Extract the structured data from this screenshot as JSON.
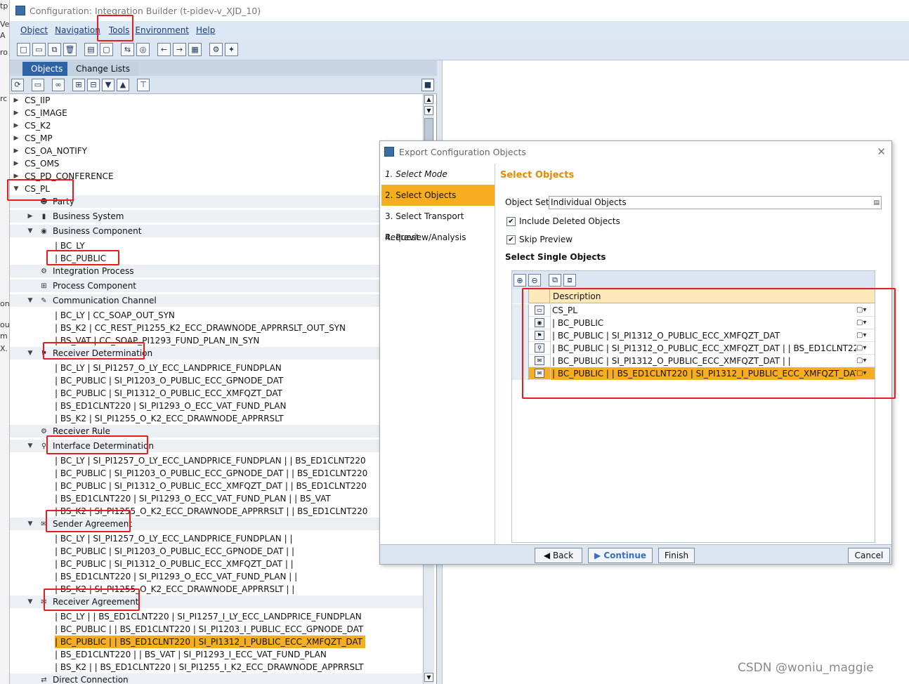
{
  "window": {
    "title": "Configuration: Integration Builder (t-pidev-v_XJD_10)"
  },
  "menu": [
    "Object",
    "Navigation",
    "Tools",
    "Environment",
    "Help"
  ],
  "background_strip": [
    "tp",
    "Ve",
    "A",
    "ro",
    "rc",
    "on",
    "ou",
    "m",
    "X."
  ],
  "left_pane": {
    "tabs": [
      "Objects",
      "Change Lists"
    ],
    "tree": [
      {
        "label": "CS_IIP",
        "arrow": "▶",
        "icon": "none"
      },
      {
        "label": "CS_IMAGE",
        "arrow": "▶",
        "icon": "none"
      },
      {
        "label": "CS_K2",
        "arrow": "▶",
        "icon": "none"
      },
      {
        "label": "CS_MP",
        "arrow": "▶",
        "icon": "none"
      },
      {
        "label": "CS_OA_NOTIFY",
        "arrow": "▶",
        "icon": "none"
      },
      {
        "label": "CS_OMS",
        "arrow": "▶",
        "icon": "none"
      },
      {
        "label": "CS_PD_CONFERENCE",
        "arrow": "▶",
        "icon": "none"
      },
      {
        "label": "CS_PL",
        "arrow": "▼",
        "icon": "none"
      },
      {
        "label": "Party",
        "arrow": "",
        "icon": "party-icon"
      },
      {
        "label": "Business System",
        "arrow": "▶",
        "icon": "business-system-icon"
      },
      {
        "label": "Business Component",
        "arrow": "▼",
        "icon": "business-component-icon"
      },
      {
        "label": "| BC_LY",
        "arrow": "",
        "icon": "none"
      },
      {
        "label": "| BC_PUBLIC",
        "arrow": "",
        "icon": "none"
      },
      {
        "label": "Integration Process",
        "arrow": "",
        "icon": "integration-process-icon"
      },
      {
        "label": "Process Component",
        "arrow": "",
        "icon": "process-component-icon"
      },
      {
        "label": "Communication Channel",
        "arrow": "▼",
        "icon": "channel-icon"
      },
      {
        "label": "| BC_LY | CC_SOAP_OUT_SYN",
        "arrow": "",
        "icon": "none"
      },
      {
        "label": "| BS_K2 | CC_REST_PI1255_K2_ECC_DRAWNODE_APPRRSLT_OUT_SYN",
        "arrow": "",
        "icon": "none"
      },
      {
        "label": "| BS_VAT | CC_SOAP_PI1293_FUND_PLAN_IN_SYN",
        "arrow": "",
        "icon": "none"
      },
      {
        "label": "Receiver Determination",
        "arrow": "▼",
        "icon": "receiver-determination-icon"
      },
      {
        "label": "| BC_LY | SI_PI1257_O_LY_ECC_LANDPRICE_FUNDPLAN",
        "arrow": "",
        "icon": "none"
      },
      {
        "label": "| BC_PUBLIC | SI_PI1203_O_PUBLIC_ECC_GPNODE_DAT",
        "arrow": "",
        "icon": "none"
      },
      {
        "label": "| BC_PUBLIC | SI_PI1312_O_PUBLIC_ECC_XMFQZT_DAT",
        "arrow": "",
        "icon": "none"
      },
      {
        "label": "| BS_ED1CLNT220 | SI_PI1293_O_ECC_VAT_FUND_PLAN",
        "arrow": "",
        "icon": "none"
      },
      {
        "label": "| BS_K2 | SI_PI1255_O_K2_ECC_DRAWNODE_APPRRSLT",
        "arrow": "",
        "icon": "none"
      },
      {
        "label": "Receiver Rule",
        "arrow": "",
        "icon": "receiver-rule-icon"
      },
      {
        "label": "Interface Determination",
        "arrow": "▼",
        "icon": "interface-determination-icon"
      },
      {
        "label": "| BC_LY | SI_PI1257_O_LY_ECC_LANDPRICE_FUNDPLAN | | BS_ED1CLNT220",
        "arrow": "",
        "icon": "none"
      },
      {
        "label": "| BC_PUBLIC | SI_PI1203_O_PUBLIC_ECC_GPNODE_DAT | | BS_ED1CLNT220",
        "arrow": "",
        "icon": "none"
      },
      {
        "label": "| BC_PUBLIC | SI_PI1312_O_PUBLIC_ECC_XMFQZT_DAT | | BS_ED1CLNT220",
        "arrow": "",
        "icon": "none"
      },
      {
        "label": "| BS_ED1CLNT220 | SI_PI1293_O_ECC_VAT_FUND_PLAN | | BS_VAT",
        "arrow": "",
        "icon": "none"
      },
      {
        "label": "| BS_K2 | SI_PI1255_O_K2_ECC_DRAWNODE_APPRRSLT | | BS_ED1CLNT220",
        "arrow": "",
        "icon": "none"
      },
      {
        "label": "Sender Agreement",
        "arrow": "▼",
        "icon": "sender-agreement-icon"
      },
      {
        "label": "| BC_LY | SI_PI1257_O_LY_ECC_LANDPRICE_FUNDPLAN | |",
        "arrow": "",
        "icon": "none"
      },
      {
        "label": "| BC_PUBLIC | SI_PI1203_O_PUBLIC_ECC_GPNODE_DAT | |",
        "arrow": "",
        "icon": "none"
      },
      {
        "label": "| BC_PUBLIC | SI_PI1312_O_PUBLIC_ECC_XMFQZT_DAT | |",
        "arrow": "",
        "icon": "none"
      },
      {
        "label": "| BS_ED1CLNT220 | SI_PI1293_O_ECC_VAT_FUND_PLAN | |",
        "arrow": "",
        "icon": "none"
      },
      {
        "label": "| BS_K2 | SI_PI1255_O_K2_ECC_DRAWNODE_APPRRSLT | |",
        "arrow": "",
        "icon": "none"
      },
      {
        "label": "Receiver Agreement",
        "arrow": "▼",
        "icon": "receiver-agreement-icon"
      },
      {
        "label": "| BC_LY | | BS_ED1CLNT220 | SI_PI1257_I_LY_ECC_LANDPRICE_FUNDPLAN",
        "arrow": "",
        "icon": "none"
      },
      {
        "label": "| BC_PUBLIC | | BS_ED1CLNT220 | SI_PI1203_I_PUBLIC_ECC_GPNODE_DAT",
        "arrow": "",
        "icon": "none"
      },
      {
        "label": "| BC_PUBLIC | | BS_ED1CLNT220 | SI_PI1312_I_PUBLIC_ECC_XMFQZT_DAT",
        "arrow": "",
        "icon": "none",
        "selected": true
      },
      {
        "label": "| BS_ED1CLNT220 | | BS_VAT | SI_PI1293_I_ECC_VAT_FUND_PLAN",
        "arrow": "",
        "icon": "none"
      },
      {
        "label": "| BS_K2 | | BS_ED1CLNT220 | SI_PI1255_I_K2_ECC_DRAWNODE_APPRRSLT",
        "arrow": "",
        "icon": "none"
      },
      {
        "label": "Direct Connection",
        "arrow": "",
        "icon": "direct-connection-icon"
      }
    ]
  },
  "dialog": {
    "title": "Export Configuration Objects",
    "steps": [
      "1. Select Mode",
      "2. Select Objects",
      "3. Select Transport Request",
      "4. Preview/Analysis"
    ],
    "active_step": 1,
    "heading": "Select Objects",
    "object_set_label": "Object Set",
    "object_set_value": "Individual Objects",
    "include_deleted_label": "Include Deleted Objects",
    "include_deleted_checked": true,
    "skip_preview_label": "Skip Preview",
    "skip_preview_checked": true,
    "single_objects_heading": "Select Single Objects",
    "table_header": "Description",
    "rows": [
      {
        "description": "CS_PL",
        "icon": "party-icon",
        "selected": false
      },
      {
        "description": "| BC_PUBLIC",
        "icon": "business-component-icon",
        "selected": false
      },
      {
        "description": "| BC_PUBLIC | SI_PI1312_O_PUBLIC_ECC_XMFQZT_DAT",
        "icon": "receiver-determination-icon",
        "selected": false
      },
      {
        "description": "| BC_PUBLIC | SI_PI1312_O_PUBLIC_ECC_XMFQZT_DAT | | BS_ED1CLNT22",
        "icon": "interface-determination-icon",
        "selected": false
      },
      {
        "description": "| BC_PUBLIC | SI_PI1312_O_PUBLIC_ECC_XMFQZT_DAT | |",
        "icon": "sender-agreement-icon",
        "selected": false
      },
      {
        "description": "| BC_PUBLIC | | BS_ED1CLNT220 | SI_PI1312_I_PUBLIC_ECC_XMFQZT_DAT",
        "icon": "receiver-agreement-icon",
        "selected": true
      }
    ],
    "buttons": {
      "back": "Back",
      "continue": "Continue",
      "finish": "Finish",
      "cancel": "Cancel"
    }
  },
  "watermark": "CSDN @woniu_maggie",
  "colors": {
    "accent": "#f6ae20",
    "tab_active": "#2e64a6",
    "annotation": "#e81c1c",
    "heading": "#e68a00"
  }
}
